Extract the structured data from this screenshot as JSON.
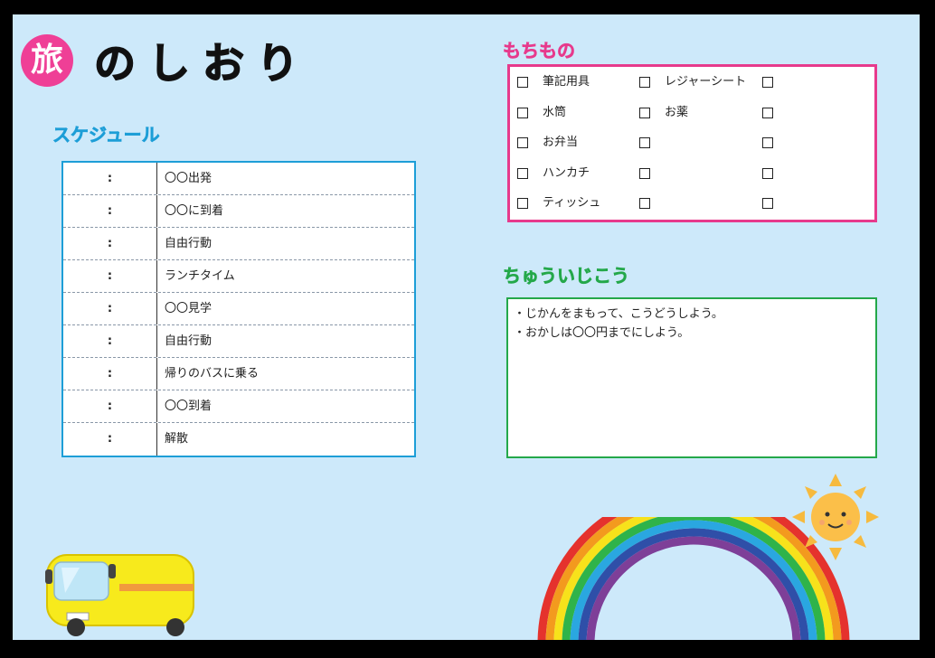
{
  "title": {
    "badge": "旅",
    "text": "のしおり",
    "badge_color": "#ef3f96"
  },
  "schedule": {
    "heading": "スケジュール",
    "color": "#1d9ed7",
    "rows": [
      {
        "time": ":",
        "event": "〇〇出発"
      },
      {
        "time": ":",
        "event": "〇〇に到着"
      },
      {
        "time": ":",
        "event": "自由行動"
      },
      {
        "time": ":",
        "event": "ランチタイム"
      },
      {
        "time": ":",
        "event": "〇〇見学"
      },
      {
        "time": ":",
        "event": "自由行動"
      },
      {
        "time": ":",
        "event": "帰りのバスに乗る"
      },
      {
        "time": ":",
        "event": "〇〇到着"
      },
      {
        "time": ":",
        "event": "解散"
      }
    ]
  },
  "belongings": {
    "heading": "もちもの",
    "color": "#e73a8c",
    "rows": [
      [
        "筆記用具",
        "レジャーシート",
        ""
      ],
      [
        "水筒",
        "お薬",
        ""
      ],
      [
        "お弁当",
        "",
        ""
      ],
      [
        "ハンカチ",
        "",
        ""
      ],
      [
        "ティッシュ",
        "",
        ""
      ]
    ]
  },
  "notes": {
    "heading": "ちゅういじこう",
    "color": "#24a84a",
    "lines": [
      "・じかんをまもって、こうどうしよう。",
      "・おかしは〇〇円までにしよう。"
    ]
  },
  "illustrations": [
    "bus-illustration",
    "rainbow-illustration",
    "sun-illustration"
  ]
}
